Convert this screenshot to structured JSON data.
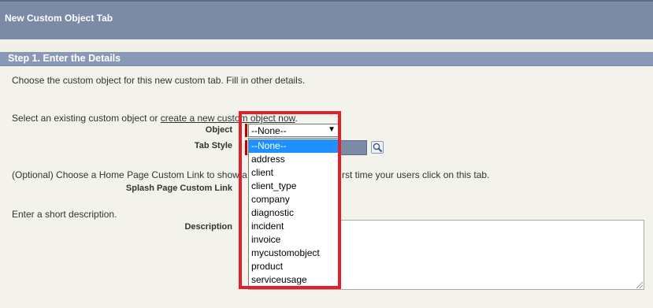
{
  "header": {
    "title": "New Custom Object Tab"
  },
  "step": {
    "title": "Step 1. Enter the Details"
  },
  "intro": "Choose the custom object for this new custom tab. Fill in other details.",
  "select_existing": {
    "prefix": "Select an existing custom object or ",
    "link": "create a new custom object now",
    "suffix": "."
  },
  "fields": {
    "object_label": "Object",
    "tab_style_label": "Tab Style",
    "splash_label": "Splash Page Custom Link",
    "description_label": "Description"
  },
  "object_select": {
    "value": "--None--",
    "options": [
      "--None--",
      "address",
      "client",
      "client_type",
      "company",
      "diagnostic",
      "incident",
      "invoice",
      "mycustomobject",
      "product",
      "serviceusage"
    ],
    "selected_index": 0
  },
  "optional_text": {
    "left": "(Optional) Choose a Home Page Custom Link to show a",
    "right": "rst time your users click on this tab."
  },
  "short_description": "Enter a short description.",
  "colors": {
    "header_bg": "#7d8aa5",
    "step_bg": "#8a98b8",
    "panel_bg": "#f3f3ec",
    "highlight_box": "#e0202a",
    "option_selected": "#1e90ff",
    "required_bar": "#c00000"
  },
  "icons": {
    "lookup": "lookup-icon",
    "dropdown": "chevron-down-icon"
  }
}
